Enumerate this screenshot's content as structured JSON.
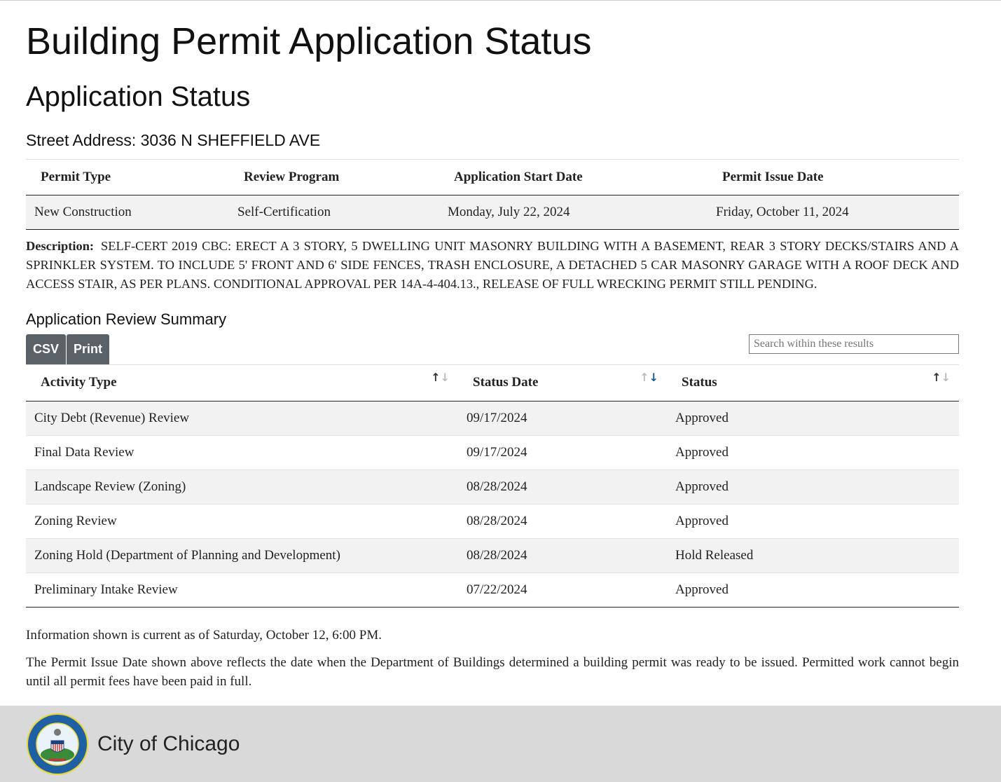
{
  "page": {
    "title": "Building Permit Application Status",
    "subtitle": "Application Status",
    "address_label": "Street Address: 3036 N SHEFFIELD AVE"
  },
  "permit": {
    "headers": [
      "Permit Type",
      "Review Program",
      "Application Start Date",
      "Permit Issue Date"
    ],
    "row": [
      "New Construction",
      "Self-Certification",
      "Monday, July 22, 2024",
      "Friday, October 11, 2024"
    ]
  },
  "description": {
    "label": "Description:",
    "text": "SELF-CERT 2019 CBC: ERECT A 3 STORY, 5 DWELLING UNIT MASONRY BUILDING WITH A BASEMENT, REAR 3 STORY DECKS/STAIRS AND A SPRINKLER SYSTEM. TO INCLUDE 5' FRONT AND 6' SIDE FENCES, TRASH ENCLOSURE, A DETACHED 5 CAR MASONRY GARAGE WITH A ROOF DECK AND ACCESS STAIR, AS PER PLANS. CONDITIONAL APPROVAL PER 14A-4-404.13., RELEASE OF FULL WRECKING PERMIT STILL PENDING."
  },
  "review": {
    "title": "Application Review Summary",
    "csv": "CSV",
    "print": "Print",
    "search_placeholder": "Search within these results",
    "headers": [
      "Activity Type",
      "Status Date",
      "Status"
    ],
    "sorted_column": "Status Date",
    "sort_direction": "descending",
    "rows": [
      [
        "City Debt (Revenue) Review",
        "09/17/2024",
        "Approved"
      ],
      [
        "Final Data Review",
        "09/17/2024",
        "Approved"
      ],
      [
        "Landscape Review (Zoning)",
        "08/28/2024",
        "Approved"
      ],
      [
        "Zoning Review",
        "08/28/2024",
        "Approved"
      ],
      [
        "Zoning Hold (Department of Planning and Development)",
        "08/28/2024",
        "Hold Released"
      ],
      [
        "Preliminary Intake Review",
        "07/22/2024",
        "Approved"
      ]
    ]
  },
  "notes": {
    "current": "Information shown is current as of Saturday, October 12, 6:00 PM.",
    "issue": "The Permit Issue Date shown above reflects the date when the Department of Buildings determined a building permit was ready to be issued. Permitted work cannot begin until all permit fees have been paid in full."
  },
  "footer": {
    "title": "City of Chicago",
    "seal_text": "CITY OF CHICAGO INCORPORATED 4th MARCH 1837"
  }
}
